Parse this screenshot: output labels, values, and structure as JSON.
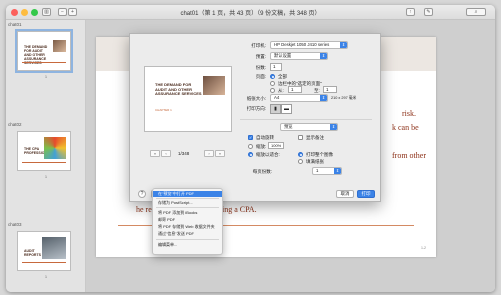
{
  "window": {
    "title": "chat01（第 1 页，共 43 页）（9 份文稿，共 348 页）",
    "toolbar_icons": [
      "sidebar-icon",
      "zoom-out-icon",
      "zoom-in-icon",
      "share-icon",
      "markup-icon",
      "search-icon"
    ]
  },
  "sidebar": {
    "header": "chat01",
    "thumbnails": [
      {
        "caption": "THE DEMAND FOR AUDIT AND OTHER ASSURANCE SERVICES",
        "page": "1"
      },
      {
        "caption": "",
        "page": "chat02"
      },
      {
        "caption": "THE CPA PROFESSION",
        "page": "1"
      },
      {
        "caption": "",
        "page": "chat03"
      },
      {
        "caption": "AUDIT REPORTS",
        "page": "1"
      }
    ]
  },
  "document": {
    "slide_title": "ES",
    "lines": [
      "risk.",
      "k can be",
      "from other",
      "he requirements for becoming a CPA."
    ],
    "page_number": "1-2"
  },
  "print_dialog": {
    "preview": {
      "title": "THE DEMAND FOR AUDIT AND OTHER ASSURANCE SERVICES",
      "subtitle": "CHAPTER 1",
      "page_indicator": "1/348"
    },
    "printer_label": "打印机:",
    "printer_value": "HP Deskjet 1050 J410 series",
    "presets_label": "预置:",
    "presets_value": "默认设置",
    "copies_label": "份数:",
    "copies_value": "1",
    "pages_label": "页面:",
    "pages_all": "全部",
    "pages_selection": "边栏中的\"选定的页面\"",
    "pages_from": "从:",
    "pages_from_value": "1",
    "pages_to": "至:",
    "pages_to_value": "1",
    "paper_label": "纸张大小:",
    "paper_value": "A4",
    "paper_dims": "210 x 297 毫米",
    "orientation_label": "打印方向:",
    "section_value": "预览",
    "auto_rotate": "自动旋转",
    "show_notes": "显示备注",
    "scale_label": "缩放:",
    "scale_value": "100%",
    "scale_fit": "缩放以适合:",
    "print_entire": "打印整个图像",
    "fill_paper": "填满纸张",
    "copies_per_page_label": "每页份数:",
    "copies_per_page_value": "1",
    "help": "?",
    "pdf_button": "PDF",
    "hide_details": "隐藏详细信息",
    "cancel": "取消",
    "print": "打印"
  },
  "pdf_menu": {
    "items": [
      "在\"预览\"中打开 PDF",
      "存储为 PostScript...",
      "将 PDF 添加到 iBooks",
      "邮寄 PDF",
      "将 PDF 存储到 Web 收据文件夹",
      "通过\"信息\"发送 PDF",
      "编辑菜单..."
    ],
    "highlighted_index": 0
  },
  "colors": {
    "accent": "#3b83e7",
    "slide_text": "#8c2f16",
    "slide_title": "#a75a38"
  }
}
